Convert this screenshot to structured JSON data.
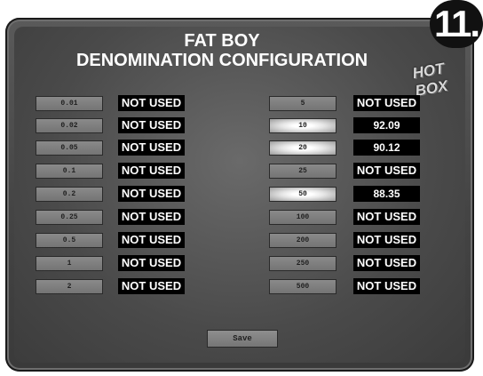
{
  "header": {
    "title_line1": "FAT BOY",
    "title_line2": "DENOMINATION CONFIGURATION",
    "step_badge": "11.",
    "logo_top": "HOT",
    "logo_bottom": "BOX"
  },
  "left_column": [
    {
      "denomination": "0.01",
      "value": "NOT USED",
      "lit": false
    },
    {
      "denomination": "0.02",
      "value": "NOT USED",
      "lit": false
    },
    {
      "denomination": "0.05",
      "value": "NOT USED",
      "lit": false
    },
    {
      "denomination": "0.1",
      "value": "NOT USED",
      "lit": false
    },
    {
      "denomination": "0.2",
      "value": "NOT USED",
      "lit": false
    },
    {
      "denomination": "0.25",
      "value": "NOT USED",
      "lit": false
    },
    {
      "denomination": "0.5",
      "value": "NOT USED",
      "lit": false
    },
    {
      "denomination": "1",
      "value": "NOT USED",
      "lit": false
    },
    {
      "denomination": "2",
      "value": "NOT USED",
      "lit": false
    }
  ],
  "right_column": [
    {
      "denomination": "5",
      "value": "NOT USED",
      "lit": false
    },
    {
      "denomination": "10",
      "value": "92.09",
      "lit": true
    },
    {
      "denomination": "20",
      "value": "90.12",
      "lit": true
    },
    {
      "denomination": "25",
      "value": "NOT USED",
      "lit": false
    },
    {
      "denomination": "50",
      "value": "88.35",
      "lit": true
    },
    {
      "denomination": "100",
      "value": "NOT USED",
      "lit": false
    },
    {
      "denomination": "200",
      "value": "NOT USED",
      "lit": false
    },
    {
      "denomination": "250",
      "value": "NOT USED",
      "lit": false
    },
    {
      "denomination": "500",
      "value": "NOT USED",
      "lit": false
    }
  ],
  "actions": {
    "save_label": "Save"
  }
}
